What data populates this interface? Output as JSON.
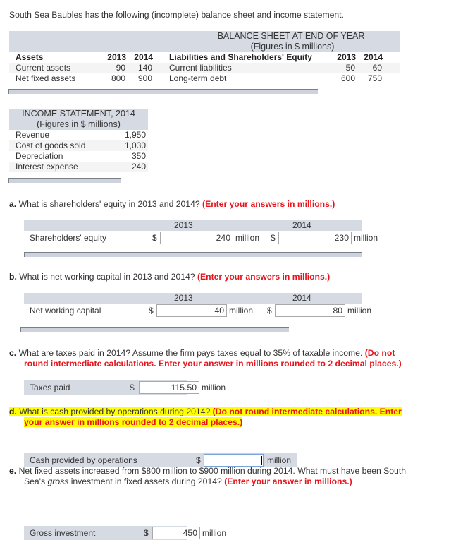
{
  "intro": "South Sea Baubles has the following (incomplete) balance sheet and income statement.",
  "balance_sheet": {
    "title": "BALANCE SHEET AT END OF YEAR",
    "subtitle": "(Figures in $ millions)",
    "assets_header": "Assets",
    "liab_header": "Liabilities and Shareholders' Equity",
    "years": [
      "2013",
      "2014"
    ],
    "assets": [
      {
        "label": "Current assets",
        "v2013": "90",
        "v2014": "140"
      },
      {
        "label": "Net fixed assets",
        "v2013": "800",
        "v2014": "900"
      }
    ],
    "liabilities": [
      {
        "label": "Current liabilities",
        "v2013": "50",
        "v2014": "60"
      },
      {
        "label": "Long-term debt",
        "v2013": "600",
        "v2014": "750"
      }
    ]
  },
  "income_statement": {
    "title": "INCOME STATEMENT, 2014",
    "subtitle": "(Figures in $ millions)",
    "rows": [
      {
        "label": "Revenue",
        "value": "1,950"
      },
      {
        "label": "Cost of goods sold",
        "value": "1,030"
      },
      {
        "label": "Depreciation",
        "value": "350"
      },
      {
        "label": "Interest expense",
        "value": "240"
      }
    ]
  },
  "questions": {
    "a": {
      "letter": "a.",
      "text": "What is shareholders' equity in 2013 and 2014?",
      "note": "(Enter your answers in millions.)",
      "row_label": "Shareholders' equity",
      "years": [
        "2013",
        "2014"
      ],
      "currency": "$",
      "unit": "million",
      "values": [
        "240",
        "230"
      ]
    },
    "b": {
      "letter": "b.",
      "text": "What is net working capital in 2013 and 2014?",
      "note": "(Enter your answers in millions.)",
      "row_label": "Net working capital",
      "years": [
        "2013",
        "2014"
      ],
      "currency": "$",
      "unit": "million",
      "values": [
        "40",
        "80"
      ]
    },
    "c": {
      "letter": "c.",
      "text": "What are taxes paid in 2014? Assume the firm pays taxes equal to 35% of taxable income.",
      "note_line1": "(Do not",
      "note_line2": "round intermediate calculations. Enter your answer in millions rounded to 2 decimal places.)",
      "row_label": "Taxes paid",
      "currency": "$",
      "unit": "million",
      "value": "115.50"
    },
    "d": {
      "letter": "d.",
      "text": "What is cash provided by operations during 2014?",
      "note_line1": "(Do not round intermediate calculations. Enter",
      "note_line2": "your answer in millions rounded to 2 decimal places.)",
      "row_label": "Cash provided by operations",
      "currency": "$",
      "unit": "million",
      "value": ""
    },
    "e": {
      "letter": "e.",
      "text_line1": "Net fixed assets increased from $800 million to $900 million during 2014. What must have been South",
      "text_line2_pre": "Sea's ",
      "text_line2_em": "gross",
      "text_line2_post": " investment in fixed assets during 2014?",
      "note": "(Enter your answer in millions.)",
      "row_label": "Gross investment",
      "currency": "$",
      "unit": "million",
      "value": "450"
    }
  },
  "colors": {
    "table_header_bg": "#d6dae3",
    "instruction_red": "#e8141c",
    "highlight_yellow": "#ffff00"
  }
}
